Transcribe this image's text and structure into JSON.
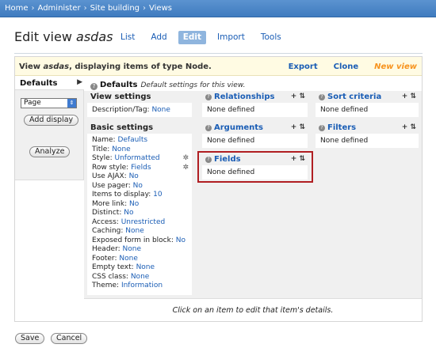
{
  "breadcrumb": [
    "Home",
    "Administer",
    "Site building",
    "Views"
  ],
  "page": {
    "title_prefix": "Edit view",
    "view_name": "asdas"
  },
  "tabs": [
    "List",
    "Add",
    "Edit",
    "Import",
    "Tools"
  ],
  "info_bar": {
    "text_prefix": "View",
    "view_name": "asdas",
    "text_suffix": ", displaying items of type Node.",
    "links": [
      "Export",
      "Clone",
      "New view"
    ]
  },
  "sidebar": {
    "defaults_tab": "Defaults",
    "display_select": "Page",
    "add_display": "Add display",
    "analyze": "Analyze"
  },
  "defaults_header": {
    "title": "Defaults",
    "description": "Default settings for this view."
  },
  "view_settings": {
    "title": "View settings",
    "rows": [
      {
        "label": "Description/Tag:",
        "value": "None"
      }
    ]
  },
  "basic_settings": {
    "title": "Basic settings",
    "rows": [
      {
        "label": "Name:",
        "value": "Defaults"
      },
      {
        "label": "Title:",
        "value": "None"
      },
      {
        "label": "Style:",
        "value": "Unformatted"
      },
      {
        "label": "Row style:",
        "value": "Fields"
      },
      {
        "label": "Use AJAX:",
        "value": "No"
      },
      {
        "label": "Use pager:",
        "value": "No"
      },
      {
        "label": "Items to display:",
        "value": "10"
      },
      {
        "label": "More link:",
        "value": "No"
      },
      {
        "label": "Distinct:",
        "value": "No"
      },
      {
        "label": "Access:",
        "value": "Unrestricted"
      },
      {
        "label": "Caching:",
        "value": "None"
      },
      {
        "label": "Exposed form in block:",
        "value": "No"
      },
      {
        "label": "Header:",
        "value": "None"
      },
      {
        "label": "Footer:",
        "value": "None"
      },
      {
        "label": "Empty text:",
        "value": "None"
      },
      {
        "label": "CSS class:",
        "value": "None"
      },
      {
        "label": "Theme:",
        "value": "Information"
      }
    ]
  },
  "panels": {
    "relationships": {
      "title": "Relationships",
      "body": "None defined"
    },
    "arguments": {
      "title": "Arguments",
      "body": "None defined"
    },
    "fields": {
      "title": "Fields",
      "body": "None defined"
    },
    "sort_criteria": {
      "title": "Sort criteria",
      "body": "None defined"
    },
    "filters": {
      "title": "Filters",
      "body": "None defined"
    }
  },
  "footer_message": "Click on an item to edit that item's details.",
  "buttons": {
    "save": "Save",
    "cancel": "Cancel"
  },
  "colors": {
    "link": "#1a5db5",
    "highlight": "#b01e22",
    "new_view": "#f7931e",
    "info_bar_bg": "#fffbe3"
  }
}
